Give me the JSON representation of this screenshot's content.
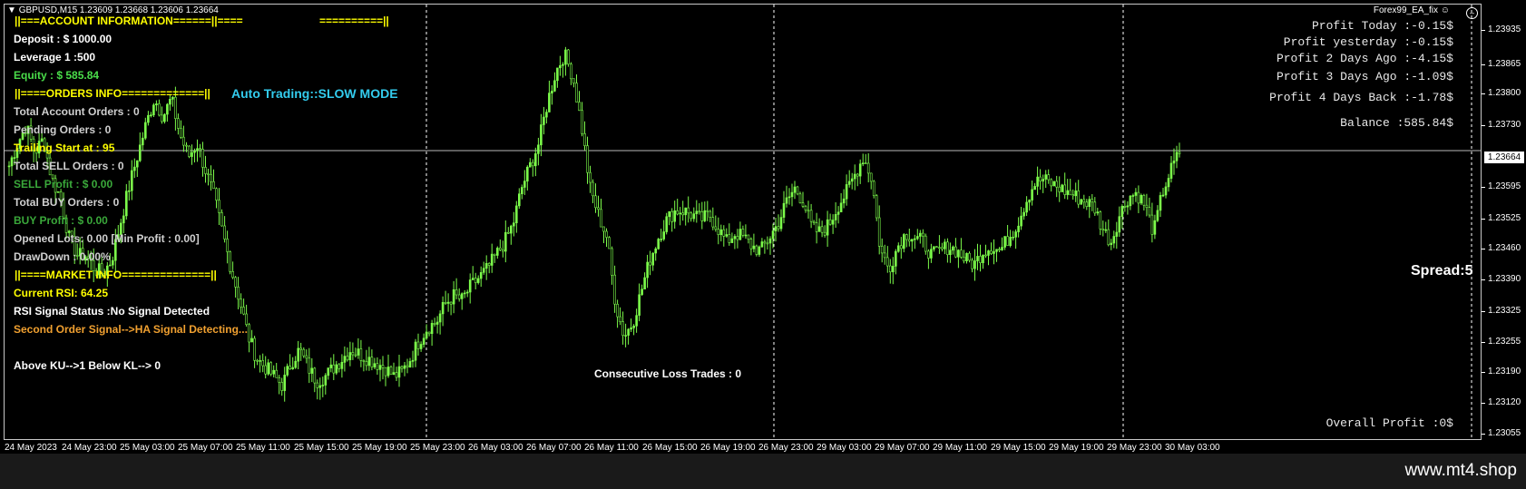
{
  "header": {
    "symbol_info": "GBPUSD,M15 1.23609 1.23668 1.23606 1.23664",
    "ea_name": "Forex99_EA_fix"
  },
  "left_panel": [
    {
      "text": "||===ACCOUNT INFORMATION======||====",
      "color": "#ffff00"
    },
    {
      "text": "Deposit : $ 1000.00",
      "color": "#ffffff"
    },
    {
      "text": "Leverage 1 :500",
      "color": "#ffffff"
    },
    {
      "text": "Equity : $ 585.84",
      "color": "#4ade4a"
    },
    {
      "text": "||====ORDERS INFO=============||",
      "color": "#ffff00"
    },
    {
      "text": "Total Account Orders : 0",
      "color": "#d0d0d0"
    },
    {
      "text": "Pending Orders :  0",
      "color": "#d0d0d0"
    },
    {
      "text": "Trailing Start at :  95",
      "color": "#ffff00"
    },
    {
      "text": "Total SELL Orders :  0",
      "color": "#d0d0d0"
    },
    {
      "text": "SELL Profit : $ 0.00",
      "color": "#3aa83a"
    },
    {
      "text": "Total BUY Orders :  0",
      "color": "#d0d0d0"
    },
    {
      "text": "BUY Profit : $ 0.00",
      "color": "#3aa83a"
    },
    {
      "text": "Opened Lots: 0.00   [Min Profit :  0.00]",
      "color": "#d0d0d0"
    },
    {
      "text": "DrawDown : 0.00%",
      "color": "#d0d0d0"
    },
    {
      "text": "||====MARKET INFO==============||",
      "color": "#ffff00"
    },
    {
      "text": "Current RSI:  64.25",
      "color": "#ffff00"
    },
    {
      "text": "RSI Signal Status :No Signal  Detected",
      "color": "#ffffff"
    },
    {
      "text": "Second Order Signal-->HA Signal Detecting...",
      "color": "#f0a030"
    },
    {
      "text": "",
      "color": "#ffffff"
    },
    {
      "text": "Above KU-->1 Below KL--> 0",
      "color": "#ffffff"
    }
  ],
  "separator_right": "==========||",
  "auto_trading": "Auto Trading::SLOW MODE",
  "consecutive_loss": "Consecutive Loss Trades :   0",
  "right_panel": {
    "profit_today": "Profit Today :-0.15$",
    "profit_yesterday": "Profit yesterday :-0.15$",
    "profit_2days": "Profit 2 Days Ago :-4.15$",
    "profit_3days": "Profit 3 Days Ago :-1.09$",
    "profit_4days": "Profit 4 Days Back :-1.78$",
    "balance": "Balance :585.84$",
    "spread": "Spread:5",
    "overall_profit": "Overall Profit :0$"
  },
  "y_axis": {
    "ticks": [
      "1.23935",
      "1.23865",
      "1.23800",
      "1.23730",
      "1.23595",
      "1.23525",
      "1.23460",
      "1.23390",
      "1.23325",
      "1.23255",
      "1.23190",
      "1.23120",
      "1.23055"
    ],
    "current_price": "1.23664"
  },
  "x_axis": {
    "ticks": [
      "24 May 2023",
      "24 May 23:00",
      "25 May 03:00",
      "25 May 07:00",
      "25 May 11:00",
      "25 May 15:00",
      "25 May 19:00",
      "25 May 23:00",
      "26 May 03:00",
      "26 May 07:00",
      "26 May 11:00",
      "26 May 15:00",
      "26 May 19:00",
      "26 May 23:00",
      "29 May 03:00",
      "29 May 07:00",
      "29 May 11:00",
      "29 May 15:00",
      "29 May 19:00",
      "29 May 23:00",
      "30 May 03:00"
    ]
  },
  "footer": {
    "site": "www.mt4.shop"
  },
  "colors": {
    "candle": "#7cfc4a",
    "background": "#000000",
    "grid": "#ffffff",
    "yellow": "#ffff00"
  },
  "chart_data": {
    "type": "candlestick",
    "ylim": [
      1.2302,
      1.2399
    ],
    "last": 1.23664,
    "path": [
      1.2363,
      1.2368,
      1.2372,
      1.2366,
      1.2369,
      1.236,
      1.2356,
      1.2347,
      1.2343,
      1.2343,
      1.234,
      1.2339,
      1.2342,
      1.235,
      1.2358,
      1.2365,
      1.2372,
      1.2378,
      1.2374,
      1.2378,
      1.237,
      1.2365,
      1.2368,
      1.2362,
      1.2356,
      1.2348,
      1.234,
      1.2333,
      1.2325,
      1.232,
      1.2318,
      1.2316,
      1.2314,
      1.2319,
      1.2322,
      1.2318,
      1.2315,
      1.2316,
      1.2318,
      1.232,
      1.2322,
      1.2321,
      1.232,
      1.2319,
      1.2318,
      1.2316,
      1.2317,
      1.232,
      1.2324,
      1.2327,
      1.2328,
      1.2332,
      1.2334,
      1.2333,
      1.2336,
      1.2338,
      1.234,
      1.2343,
      1.2346,
      1.235,
      1.2358,
      1.2363,
      1.2368,
      1.2377,
      1.2384,
      1.2388,
      1.2383,
      1.2372,
      1.2358,
      1.2352,
      1.2347,
      1.2332,
      1.2325,
      1.2328,
      1.2335,
      1.2342,
      1.2347,
      1.2351,
      1.2353,
      1.2353,
      1.2352,
      1.2351,
      1.2352,
      1.2349,
      1.2346,
      1.2348,
      1.2347,
      1.2345,
      1.2344,
      1.2347,
      1.235,
      1.2355,
      1.2358,
      1.2355,
      1.2349,
      1.2348,
      1.235,
      1.2354,
      1.2357,
      1.2361,
      1.2365,
      1.236,
      1.2344,
      1.234,
      1.2345,
      1.2348,
      1.2347,
      1.2346,
      1.2343,
      1.2344,
      1.2345,
      1.2344,
      1.2342,
      1.2341,
      1.2344,
      1.2345,
      1.2344,
      1.2347,
      1.235,
      1.2355,
      1.2359,
      1.236,
      1.2359,
      1.2358,
      1.2357,
      1.2356,
      1.2355,
      1.2354,
      1.2349,
      1.2346,
      1.2352,
      1.2356,
      1.2357,
      1.2354,
      1.2348,
      1.2357,
      1.2362,
      1.2366
    ]
  }
}
